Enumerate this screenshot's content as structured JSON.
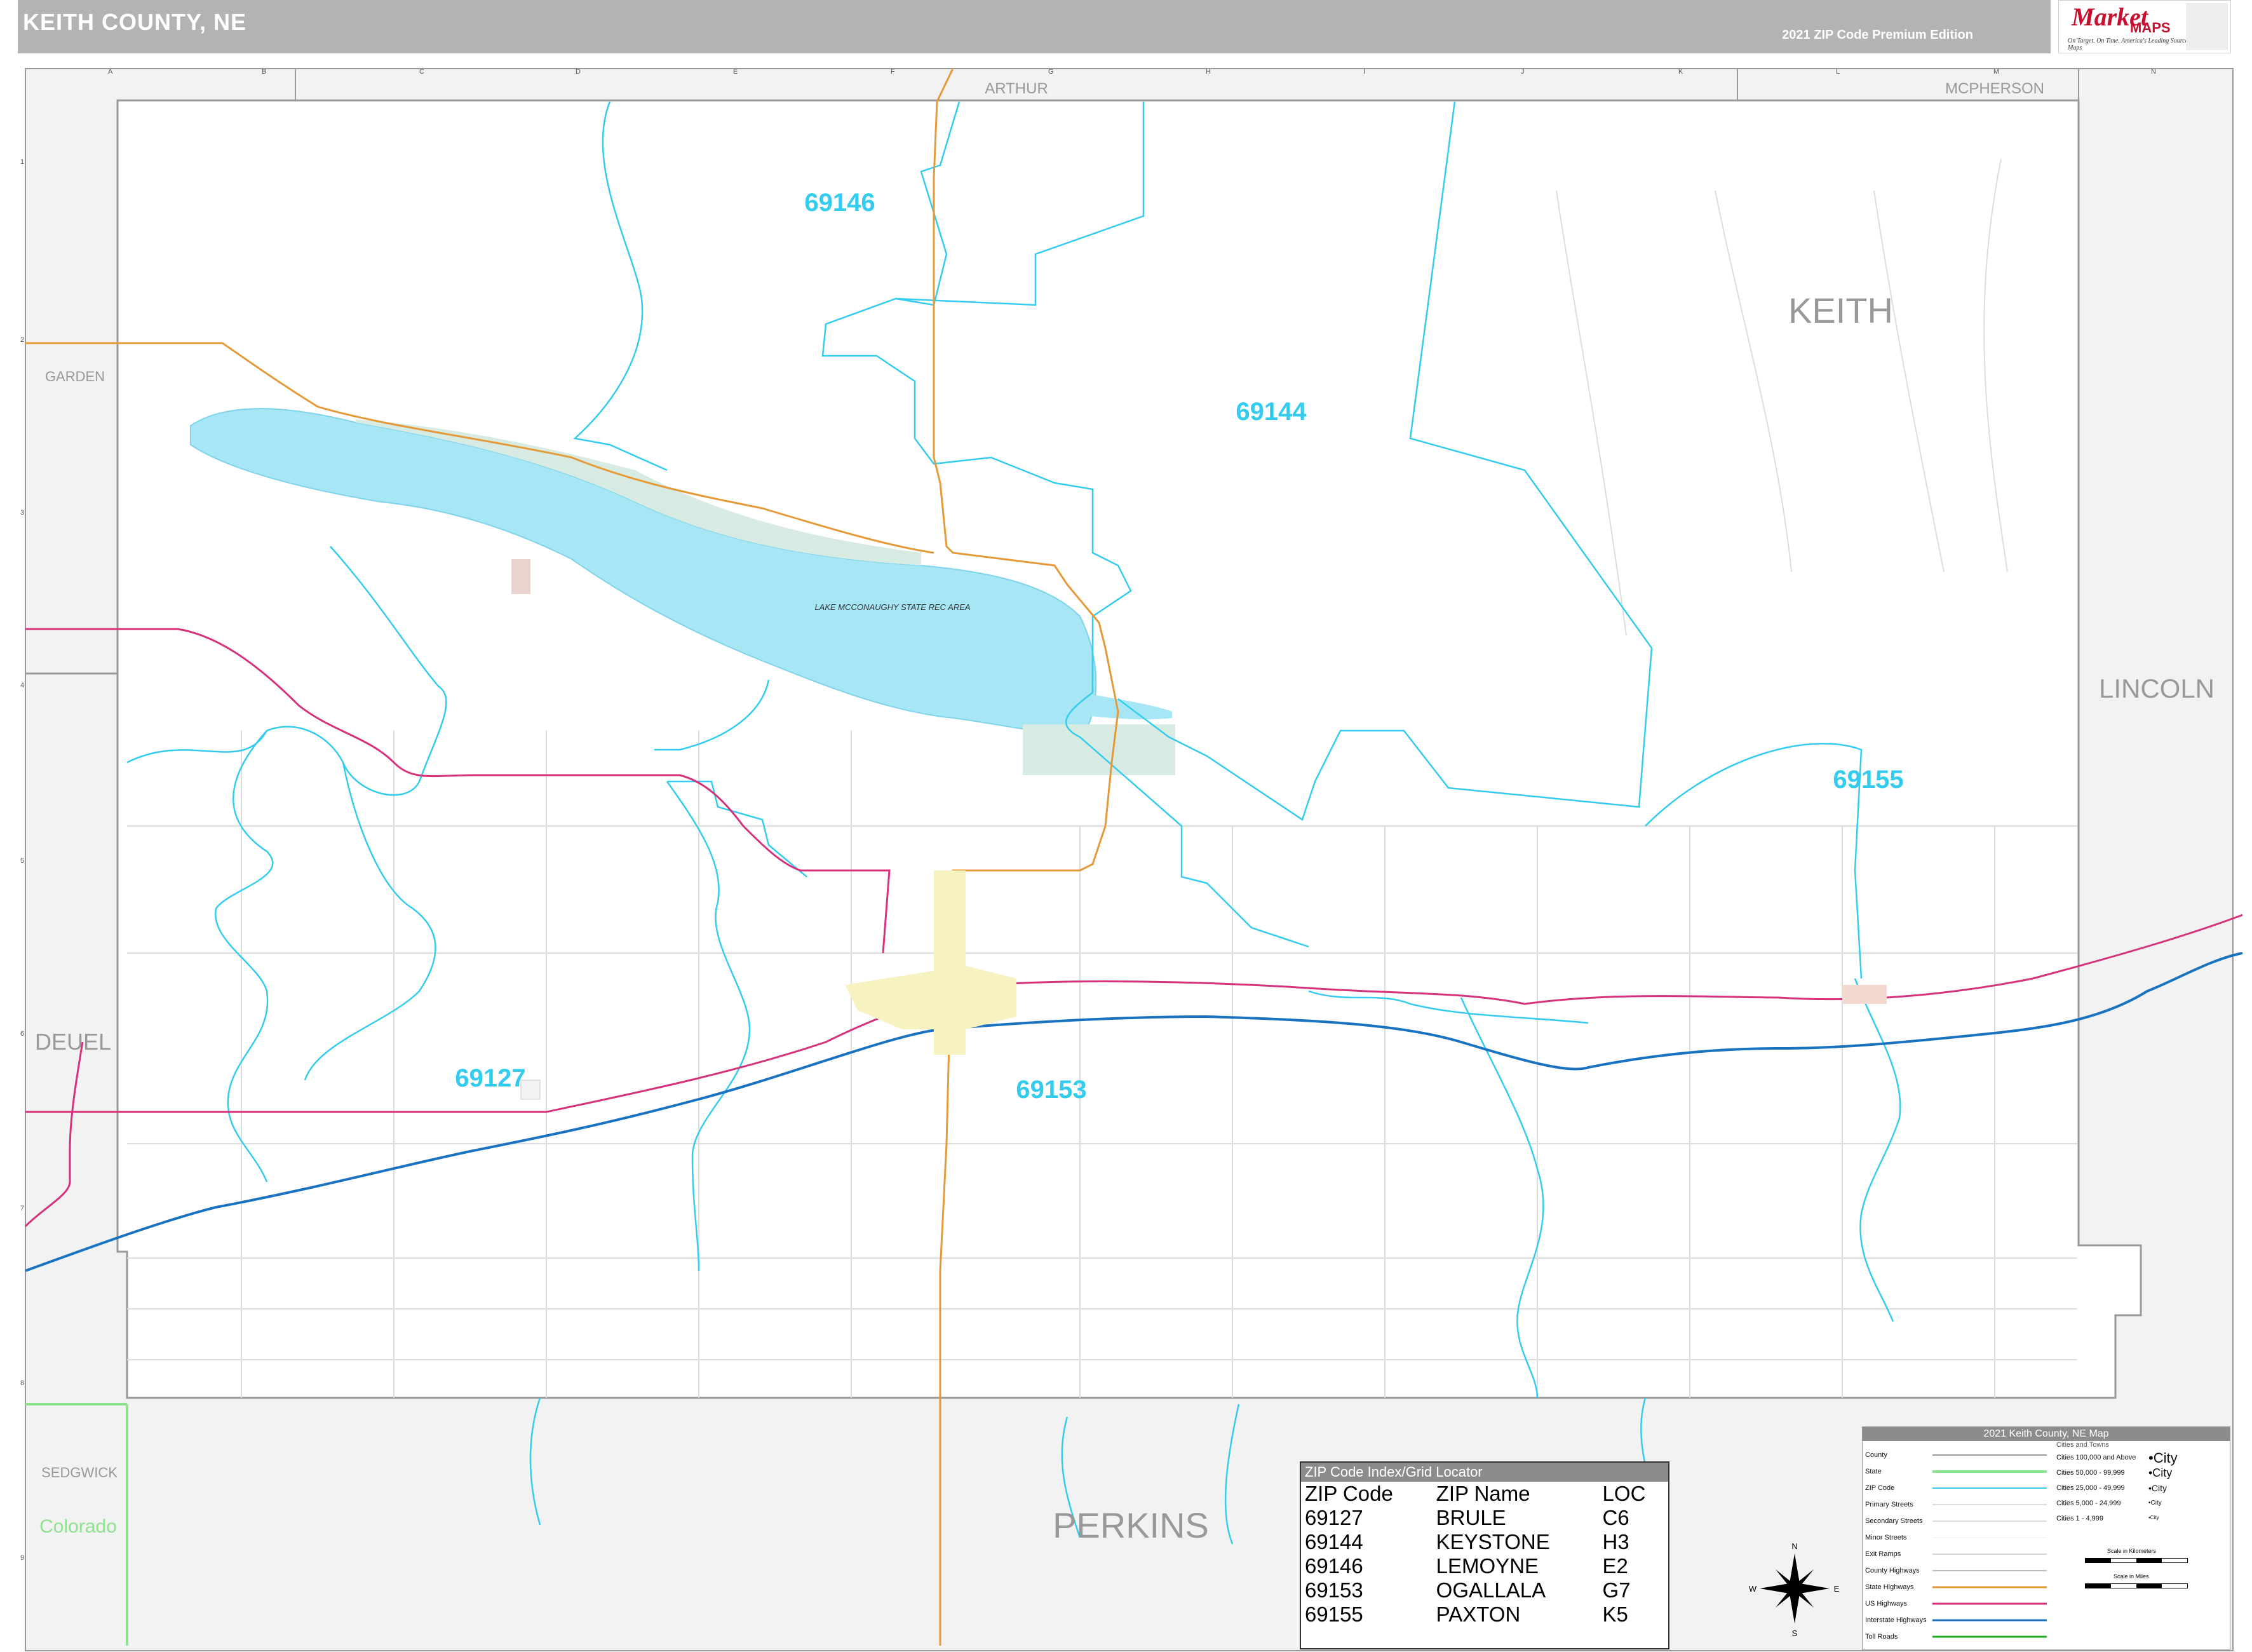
{
  "header": {
    "title": "KEITH COUNTY, NE",
    "edition": "2021 ZIP Code Premium Edition"
  },
  "logo": {
    "brand": "Market",
    "maps": "MAPS",
    "tagline": "On Target. On Time. America's Leading Source of Business Maps"
  },
  "grid": {
    "columns": [
      "A",
      "B",
      "C",
      "D",
      "E",
      "F",
      "G",
      "H",
      "I",
      "J",
      "K",
      "L",
      "M",
      "N"
    ],
    "rows": [
      "1",
      "2",
      "3",
      "4",
      "5",
      "6",
      "7",
      "8",
      "9"
    ]
  },
  "counties": {
    "keith": "KEITH",
    "arthur": "ARTHUR",
    "mcpherson": "MCPHERSON",
    "garden": "GARDEN",
    "lincoln": "LINCOLN",
    "deuel": "DEUEL",
    "sedgwick": "SEDGWICK",
    "colorado": "Colorado",
    "perkins": "PERKINS"
  },
  "zips_on_map": [
    "69146",
    "69144",
    "69155",
    "69127",
    "69153"
  ],
  "features": {
    "lake": "LAKE MCCONAUGHY STATE REC AREA"
  },
  "zip_index": {
    "title": "ZIP Code Index/Grid Locator",
    "headers": [
      "ZIP Code",
      "ZIP Name",
      "LOC"
    ],
    "rows": [
      [
        "69127",
        "BRULE",
        "C6"
      ],
      [
        "69144",
        "KEYSTONE",
        "H3"
      ],
      [
        "69146",
        "LEMOYNE",
        "E2"
      ],
      [
        "69153",
        "OGALLALA",
        "G7"
      ],
      [
        "69155",
        "PAXTON",
        "K5"
      ]
    ]
  },
  "legend": {
    "title": "2021 Keith County, NE Map",
    "items": [
      "County",
      "State",
      "ZIP Code",
      "Primary Streets",
      "Secondary Streets",
      "Minor Streets",
      "Exit Ramps",
      "County Highways",
      "State Highways",
      "US Highways",
      "Interstate Highways",
      "Toll Roads"
    ],
    "cities_title": "Cities and Towns",
    "city_sizes": [
      "Cities 100,000 and Above",
      "Cities 50,000 - 99,999",
      "Cities 25,000 - 49,999",
      "Cities 5,000 - 24,999",
      "Cities 1 - 4,999"
    ],
    "city_marks": [
      "•City",
      "•City",
      "•City",
      "•City",
      "•City"
    ],
    "scale_km": "Scale in Kilometers",
    "scale_mi": "Scale in Miles"
  },
  "compass": {
    "n": "N",
    "s": "S",
    "e": "E",
    "w": "W"
  },
  "colors": {
    "water": "#a6e6f5",
    "zip_boundary": "#33ccee",
    "interstate": "#1a73c0",
    "us_highway": "#d6327c",
    "state_highway": "#e59a3a",
    "urban": "#f7f3c0",
    "outside_county": "#f2f2f2"
  }
}
